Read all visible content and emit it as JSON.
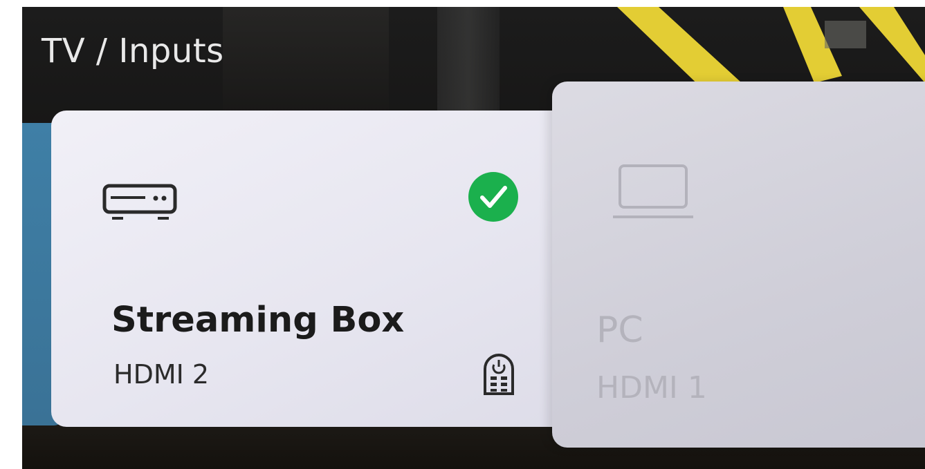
{
  "header": {
    "title": "TV / Inputs"
  },
  "inputs": [
    {
      "name": "Streaming Box",
      "port": "HDMI 2",
      "icon": "set-top-box-icon",
      "selected": true,
      "status_icon": "checkmark-icon",
      "control_icon": "remote-control-icon"
    },
    {
      "name": "PC",
      "port": "HDMI 1",
      "icon": "monitor-icon",
      "selected": false
    }
  ],
  "colors": {
    "selected_badge": "#1bb04d",
    "peek_card": "#3f7fa6",
    "background": "#141312",
    "ribbon": "#e3cd34"
  }
}
